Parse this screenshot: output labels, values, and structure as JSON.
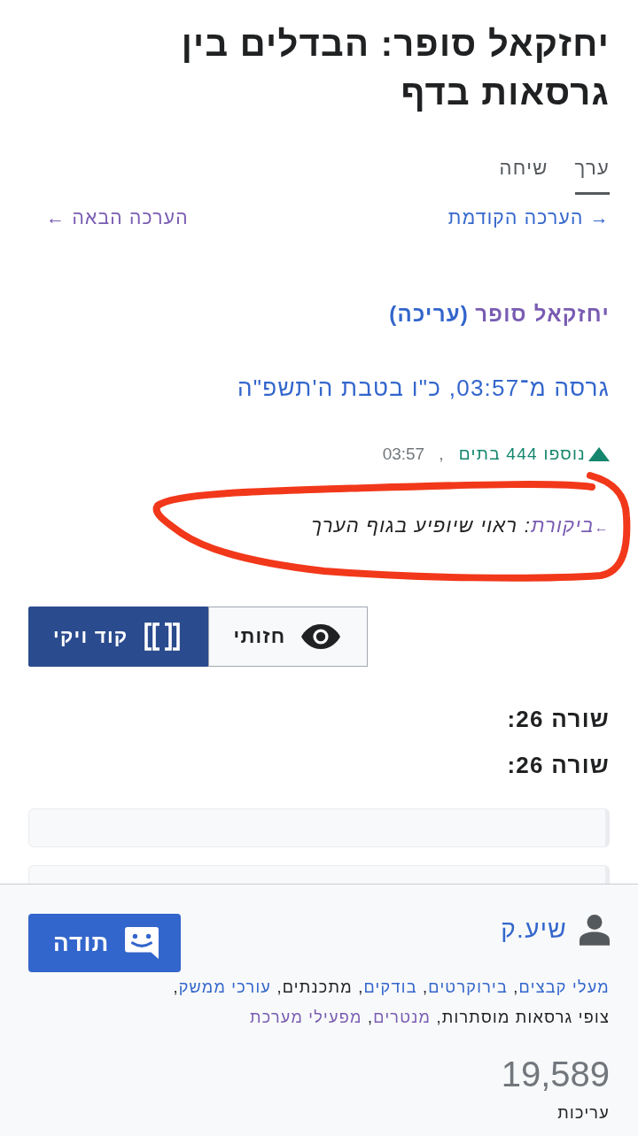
{
  "page": {
    "title": "יחזקאל סופר: הבדלים בין גרסאות בדף"
  },
  "tabs": [
    {
      "label": "ערך",
      "selected": true
    },
    {
      "label": "שיחה",
      "selected": false
    }
  ],
  "revision_nav": [
    {
      "label": "→ הערכה הקודמת",
      "visited": false
    },
    {
      "label": "הערכה הבאה ←",
      "visited": true
    }
  ],
  "revision": {
    "author": {
      "label": "יחזקאל סופר",
      "visited": true
    },
    "edit_link": {
      "label": "(עריכה)",
      "visited": false
    },
    "revision_link": {
      "label": "גרסה מ־03:57, כ\"ו בטבת ה'תשפ\"ה",
      "visited": false
    },
    "size_change": {
      "kind": "added",
      "label": "נוספו 444 בתים"
    },
    "separator": ",",
    "time": "03:57",
    "summary": {
      "section_arrow": "←",
      "section": "ביקורת",
      "text": ": ראוי שיופיע בגוף הערך",
      "circled": true
    }
  },
  "view_toggle": [
    {
      "kind": "visual",
      "label": "חזותי",
      "selected": false
    },
    {
      "kind": "wikitext",
      "label": "קוד ויקי",
      "selected": true
    }
  ],
  "diff": {
    "line_headers": [
      "שורה 26:",
      "שורה 26:"
    ],
    "lines": [
      {
        "kind": "context"
      },
      {
        "kind": "context"
      }
    ]
  },
  "user_card": {
    "username": "שיע.ק",
    "thank_button": "תודה",
    "groups": [
      {
        "label": "מעלי קבצים",
        "kind": "link"
      },
      {
        "label": "בירוקרטים",
        "kind": "link"
      },
      {
        "label": "בודקים",
        "kind": "link"
      },
      {
        "label": "מתכנתים",
        "kind": "text"
      },
      {
        "label": "עורכי ממשק",
        "kind": "link"
      },
      {
        "label": "צופי גרסאות מוסתרות",
        "kind": "text"
      },
      {
        "label": "מנטרים",
        "kind": "visited_link"
      },
      {
        "label": "מפעילי מערכת",
        "kind": "visited_link"
      }
    ],
    "group_separator": ", ",
    "edit_count": "19,589",
    "edit_count_label": "עריכות"
  }
}
